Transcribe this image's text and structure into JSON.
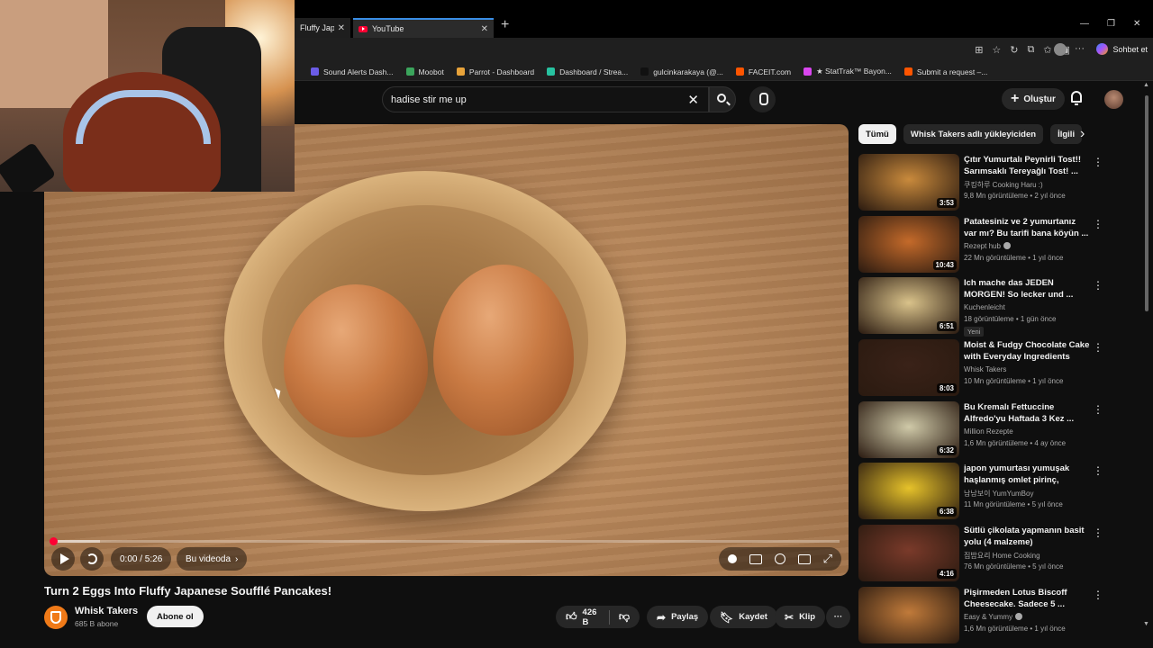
{
  "browser": {
    "tabs": [
      {
        "label": "Fluffy Japane"
      },
      {
        "label": "YouTube"
      }
    ],
    "bookmarks": [
      {
        "label": "Sound Alerts Dash...",
        "color": "#6b5ce7"
      },
      {
        "label": "Moobot",
        "color": "#3ba55c"
      },
      {
        "label": "Parrot - Dashboard",
        "color": "#e8a33a"
      },
      {
        "label": "Dashboard / Strea...",
        "color": "#27c2a0"
      },
      {
        "label": "gulcinkarakaya (@...",
        "color": "#111111"
      },
      {
        "label": "FACEIT.com",
        "color": "#ff5500"
      },
      {
        "label": "★ StatTrak™ Bayon...",
        "color": "#d946ef"
      },
      {
        "label": "Submit a request –...",
        "color": "#ff5500"
      }
    ],
    "copilot_label": "Sohbet et"
  },
  "header": {
    "search_value": "hadise stir me up",
    "create_label": "Oluştur"
  },
  "player": {
    "time": "0:00 / 5:26",
    "chapters_label": "Bu videoda",
    "progress_played": 0.0,
    "progress_buffered": 0.06
  },
  "video": {
    "title": "Turn 2 Eggs Into Fluffy Japanese Soufflé Pancakes!",
    "channel": "Whisk Takers",
    "subscribers": "685 B abone",
    "subscribe_label": "Abone ol",
    "likes": "426 B",
    "share_label": "Paylaş",
    "save_label": "Kaydet",
    "clip_label": "Klip"
  },
  "sidebar": {
    "chips": [
      "Tümü",
      "Whisk Takers adlı yükleyiciden",
      "İlgili"
    ],
    "recommendations": [
      {
        "title": "Çıtır Yumurtalı Peynirli Tost!! Sarımsaklı Tereyağlı Tost! ...",
        "channel": "쿠킹하루 Cooking Haru :)",
        "meta": "9,8 Mn görüntüleme • 2 yıl önce",
        "duration": "3:53",
        "verified": false,
        "badge": ""
      },
      {
        "title": "Patatesiniz ve 2 yumurtanız var mı? Bu tarifi bana köyün ...",
        "channel": "Rezept hub",
        "meta": "22 Mn görüntüleme • 1 yıl önce",
        "duration": "10:43",
        "verified": true,
        "badge": ""
      },
      {
        "title": "Ich mache das JEDEN MORGEN! So lecker und ...",
        "channel": "Kuchenleicht",
        "meta": "18 görüntüleme • 1 gün önce",
        "duration": "6:51",
        "verified": false,
        "badge": "Yeni"
      },
      {
        "title": "Moist & Fudgy Chocolate Cake with Everyday Ingredients",
        "channel": "Whisk Takers",
        "meta": "10 Mn görüntüleme • 1 yıl önce",
        "duration": "8:03",
        "verified": false,
        "badge": ""
      },
      {
        "title": "Bu Kremalı Fettuccine Alfredo'yu Haftada 3 Kez ...",
        "channel": "Million Rezepte",
        "meta": "1,6 Mn görüntüleme • 4 ay önce",
        "duration": "6:32",
        "verified": false,
        "badge": ""
      },
      {
        "title": "japon yumurtası yumuşak haşlanmış omlet pirinç, kore'd...",
        "channel": "남남보이 YumYumBoy",
        "meta": "11 Mn görüntüleme • 5 yıl önce",
        "duration": "6:38",
        "verified": false,
        "badge": ""
      },
      {
        "title": "Sütlü çikolata yapmanın basit yolu (4 malzeme)",
        "channel": "집밥요리 Home Cooking",
        "meta": "76 Mn görüntüleme • 5 yıl önce",
        "duration": "4:16",
        "verified": false,
        "badge": ""
      },
      {
        "title": "Pişirmeden Lotus Biscoff Cheesecake. Sadece 5 ...",
        "channel": "Easy & Yummy",
        "meta": "1,6 Mn görüntüleme • 1 yıl önce",
        "duration": "",
        "verified": true,
        "badge": ""
      }
    ]
  },
  "colors": {
    "accent_red": "#ff0033",
    "background": "#0f0f0f",
    "thumbs": [
      "#c98a3c",
      "#c46a2a",
      "#d9c28a",
      "#3a2218",
      "#cfc9a8",
      "#e6c22a",
      "#7a3a2a",
      "#c07a3a"
    ]
  }
}
